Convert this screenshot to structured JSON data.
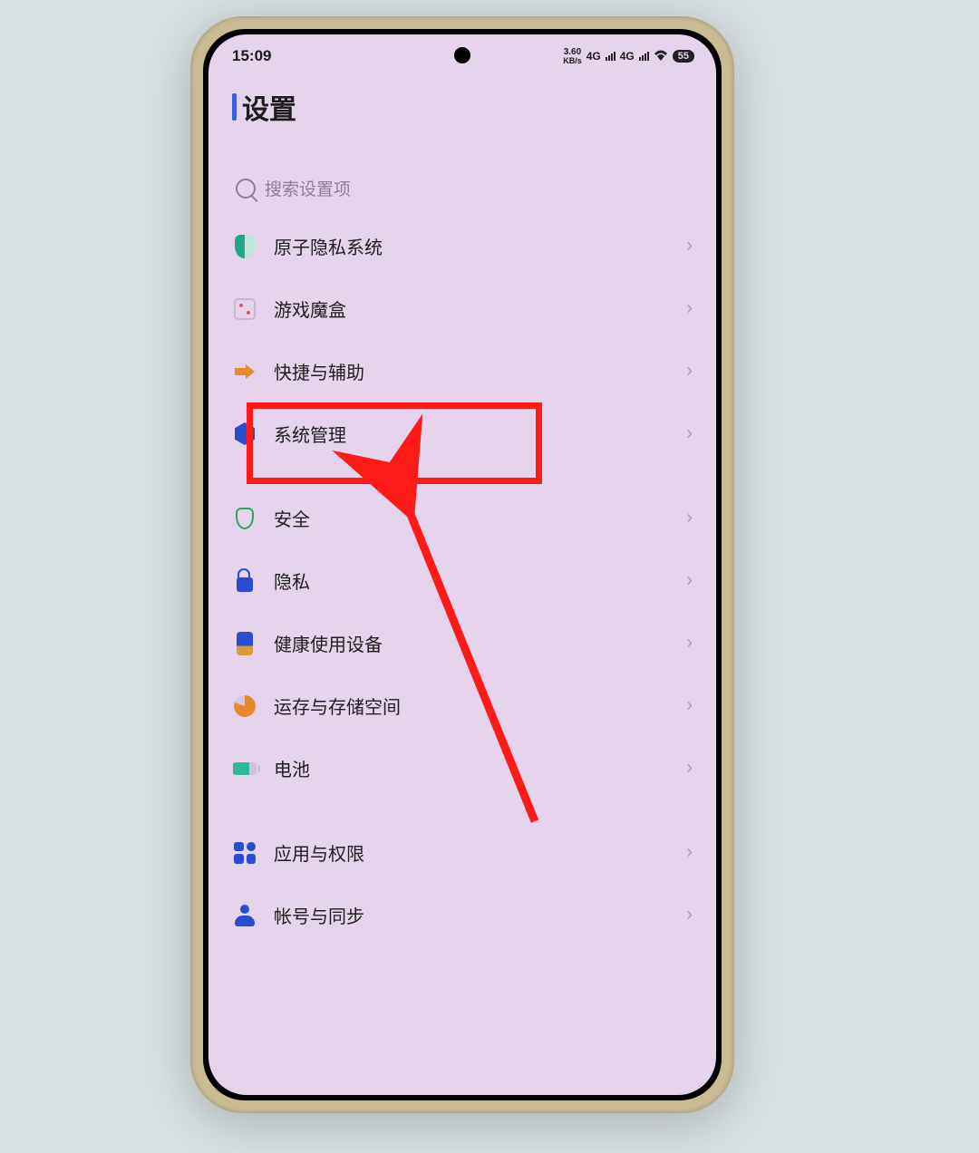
{
  "status": {
    "time": "15:09",
    "speed_value": "3.60",
    "speed_unit": "KB/s",
    "net1": "4G",
    "net2": "4G",
    "battery": "55"
  },
  "header": {
    "title": "设置"
  },
  "search": {
    "placeholder": "搜索设置项"
  },
  "items": {
    "atomic_privacy": "原子隐私系统",
    "game_box": "游戏魔盒",
    "shortcut_accessibility": "快捷与辅助",
    "system_management": "系统管理",
    "security": "安全",
    "privacy": "隐私",
    "digital_wellbeing": "健康使用设备",
    "ram_storage": "运存与存储空间",
    "battery": "电池",
    "apps_permissions": "应用与权限",
    "account_sync": "帐号与同步"
  }
}
